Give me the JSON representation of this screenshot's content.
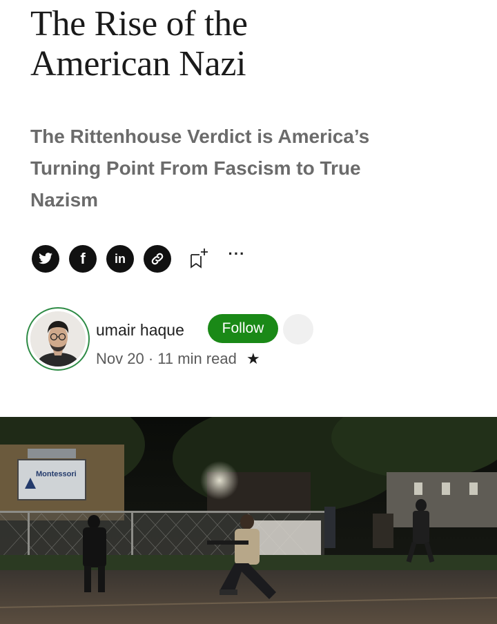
{
  "article": {
    "title_lines": [
      "The Rise of the",
      "American Nazi"
    ],
    "subtitle_lines": [
      "The Rittenhouse Verdict is America’s",
      "Turning Point From Fascism to True",
      "Nazism"
    ]
  },
  "share": {
    "icons": [
      "twitter-icon",
      "facebook-icon",
      "linkedin-icon",
      "link-icon",
      "bookmark-add-icon",
      "more-icon"
    ],
    "facebook_glyph": "f",
    "linkedin_glyph": "in",
    "more_glyph": "···"
  },
  "author": {
    "name": "umair haque",
    "follow_label": "Follow",
    "date": "Nov 20",
    "separator": "·",
    "read_time": "11 min read",
    "member_glyph": "★"
  },
  "hero_image": {
    "sign_text": "Montessori"
  },
  "colors": {
    "follow_green": "#1a8917",
    "ring_green": "#2e8b45",
    "subtitle_gray": "#6b6b6b"
  }
}
